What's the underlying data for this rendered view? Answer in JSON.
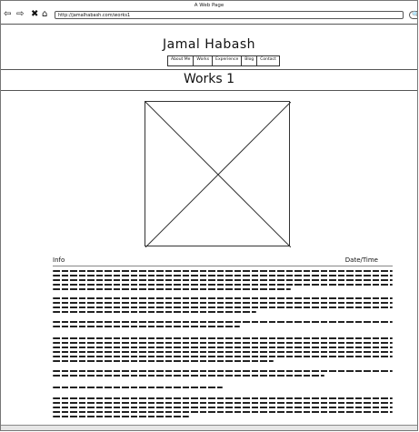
{
  "browser": {
    "window_title": "A Web Page",
    "url": "http://jamalhabash.com/works1",
    "back_icon": "back-arrow-icon",
    "forward_icon": "forward-arrow-icon",
    "stop_icon": "close-icon",
    "home_icon": "home-icon",
    "search_icon": "search-icon"
  },
  "site": {
    "title": "Jamal Habash",
    "menu": [
      "About Me",
      "Works",
      "Experience",
      "Blog",
      "Contact"
    ]
  },
  "page": {
    "title": "Works 1",
    "info_label": "Info",
    "date_label": "Date/Time"
  }
}
